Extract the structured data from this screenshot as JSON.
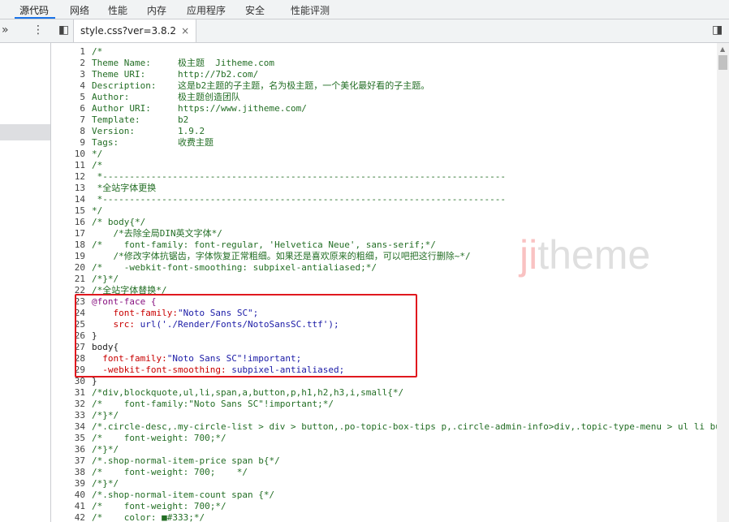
{
  "devtools": {
    "tabs": [
      "源代码",
      "网络",
      "性能",
      "内存",
      "应用程序",
      "安全",
      "性能评测"
    ],
    "active_tab": "源代码",
    "file_tab": {
      "label": "style.css?ver=3.8.2",
      "close": "×"
    },
    "toolbar_icons": {
      "expand": "»",
      "menu": "⋮",
      "toggle_navigator": "◧",
      "toggle_debugger": "◨"
    }
  },
  "watermark": {
    "part1": "ji",
    "part2": "theme"
  },
  "code_lines": [
    {
      "n": "1",
      "t": "/*",
      "c": "cm"
    },
    {
      "n": "2",
      "t": "Theme Name:     极主题  Jitheme.com",
      "c": "cm"
    },
    {
      "n": "3",
      "t": "Theme URI:      http://7b2.com/",
      "c": "cm"
    },
    {
      "n": "4",
      "t": "Description:    这是b2主题的子主题，名为极主题，一个美化最好看的子主题。",
      "c": "cm"
    },
    {
      "n": "5",
      "t": "Author:         极主题创造团队",
      "c": "cm"
    },
    {
      "n": "6",
      "t": "Author URI:     https://www.jitheme.com/",
      "c": "cm"
    },
    {
      "n": "7",
      "t": "Template:       b2",
      "c": "cm"
    },
    {
      "n": "8",
      "t": "Version:        1.9.2",
      "c": "cm"
    },
    {
      "n": "9",
      "t": "Tags:           收费主题",
      "c": "cm"
    },
    {
      "n": "10",
      "t": "*/",
      "c": "cm"
    },
    {
      "n": "11",
      "t": "/*",
      "c": "cm"
    },
    {
      "n": "12",
      "t": " *---------------------------------------------------------------------------",
      "c": "cm"
    },
    {
      "n": "13",
      "t": " *全站字体更换",
      "c": "cm"
    },
    {
      "n": "14",
      "t": " *---------------------------------------------------------------------------",
      "c": "cm"
    },
    {
      "n": "15",
      "t": "*/",
      "c": "cm"
    },
    {
      "n": "16",
      "t": "/* body{*/",
      "c": "cm"
    },
    {
      "n": "17",
      "t": "    /*去除全局DIN英文字体*/",
      "c": "cm"
    },
    {
      "n": "18",
      "t": "/*    font-family: font-regular, 'Helvetica Neue', sans-serif;*/",
      "c": "cm"
    },
    {
      "n": "19",
      "t": "    /*修改字体抗锯齿，字体恢复正常粗细。如果还是喜欢原来的粗细，可以吧把这行删除~*/",
      "c": "cm"
    },
    {
      "n": "20",
      "t": "/*    -webkit-font-smoothing: subpixel-antialiased;*/",
      "c": "cm"
    },
    {
      "n": "21",
      "t": "/*}*/",
      "c": "cm"
    },
    {
      "n": "22",
      "t": "/*全站字体替换*/",
      "c": "cm"
    },
    {
      "n": "23",
      "t": "@font-face {",
      "c": "kw"
    },
    {
      "n": "24",
      "p": "    font-family:",
      "v": "\"Noto Sans SC\";"
    },
    {
      "n": "25",
      "p": "    src:",
      "v": " url('./Render/Fonts/NotoSansSC.ttf');"
    },
    {
      "n": "26",
      "t": "}",
      "c": ""
    },
    {
      "n": "27",
      "t": "body{",
      "c": ""
    },
    {
      "n": "28",
      "p": "  font-family:",
      "v": "\"Noto Sans SC\"!important;"
    },
    {
      "n": "29",
      "p": "  -webkit-font-smoothing:",
      "v": " subpixel-antialiased;"
    },
    {
      "n": "30",
      "t": "}",
      "c": ""
    },
    {
      "n": "31",
      "t": "/*div,blockquote,ul,li,span,a,button,p,h1,h2,h3,i,small{*/",
      "c": "cm"
    },
    {
      "n": "32",
      "t": "/*    font-family:\"Noto Sans SC\"!important;*/",
      "c": "cm"
    },
    {
      "n": "33",
      "t": "/*}*/",
      "c": "cm"
    },
    {
      "n": "34",
      "t": "/*.circle-desc,.my-circle-list > div > button,.po-topic-box-tips p,.circle-admin-info>div,.topic-type-menu > ul li bu",
      "c": "cm"
    },
    {
      "n": "35",
      "t": "/*    font-weight: 700;*/",
      "c": "cm"
    },
    {
      "n": "36",
      "t": "/*}*/",
      "c": "cm"
    },
    {
      "n": "37",
      "t": "/*.shop-normal-item-price span b{*/",
      "c": "cm"
    },
    {
      "n": "38",
      "t": "/*    font-weight: 700;    */",
      "c": "cm"
    },
    {
      "n": "39",
      "t": "/*}*/",
      "c": "cm"
    },
    {
      "n": "40",
      "t": "/*.shop-normal-item-count span {*/",
      "c": "cm"
    },
    {
      "n": "41",
      "t": "/*    font-weight: 700;*/",
      "c": "cm"
    },
    {
      "n": "42",
      "t": "/*    color: ■#333;*/",
      "c": "cm"
    }
  ]
}
